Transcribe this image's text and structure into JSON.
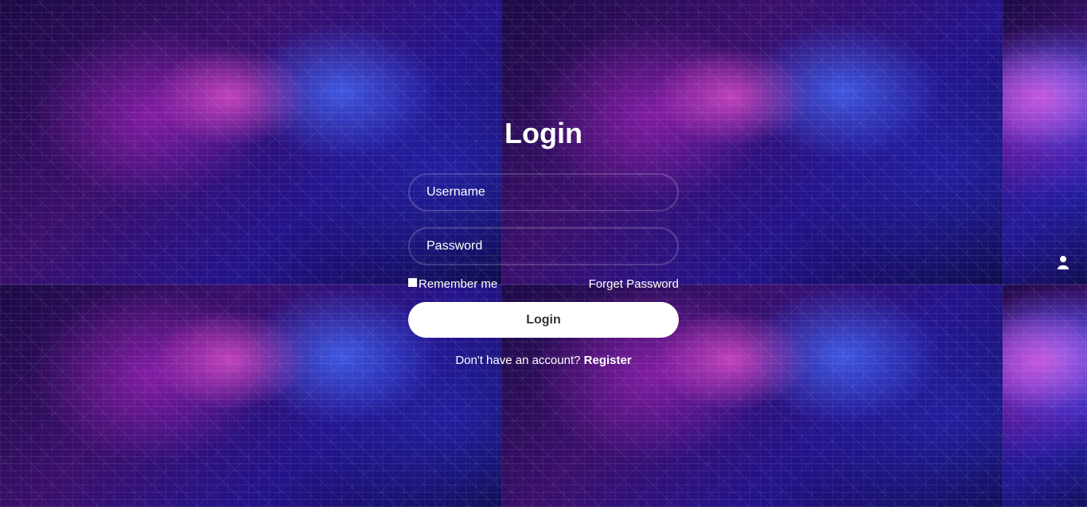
{
  "login": {
    "title": "Login",
    "username_placeholder": "Username",
    "password_placeholder": "Password",
    "remember_label": "Remember me",
    "forgot_label": "Forget Password",
    "button_label": "Login",
    "register_prompt": "Don't have an account? ",
    "register_link": "Register"
  },
  "icons": {
    "user": "user-icon",
    "lock": "lock-icon"
  },
  "colors": {
    "button_bg": "#ffffff",
    "button_text": "#333333",
    "text": "#ffffff"
  }
}
